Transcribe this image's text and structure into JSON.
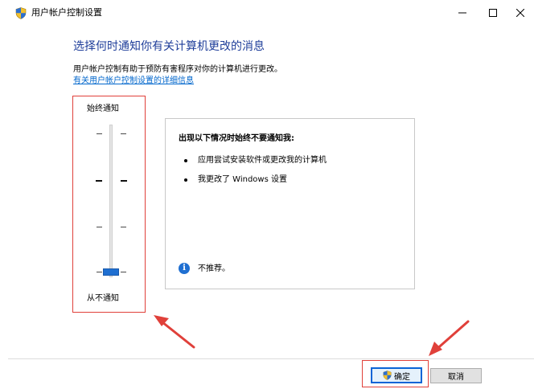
{
  "window": {
    "title": "用户帐户控制设置",
    "icon": "uac-shield-icon",
    "controls": [
      "minimize-icon",
      "maximize-icon",
      "close-icon"
    ]
  },
  "content": {
    "heading": "选择何时通知你有关计算机更改的消息",
    "description": "用户帐户控制有助于预防有害程序对你的计算机进行更改。",
    "help_link": "有关用户帐户控制设置的详细信息"
  },
  "slider": {
    "top_label": "始终通知",
    "bottom_label": "从不通知",
    "levels": 4,
    "selected_level": 1
  },
  "info_panel": {
    "title": "出现以下情况时始终不要通知我:",
    "bullets": [
      "应用尝试安装软件或更改我的计算机",
      "我更改了 Windows 设置"
    ],
    "note": "不推荐。",
    "note_icon": "info-icon"
  },
  "buttons": {
    "ok": "确定",
    "cancel": "取消"
  },
  "colors": {
    "accent": "#1f6fd1",
    "heading": "#1f3e9a",
    "link": "#0066cc",
    "annotation": "#e0403a"
  }
}
